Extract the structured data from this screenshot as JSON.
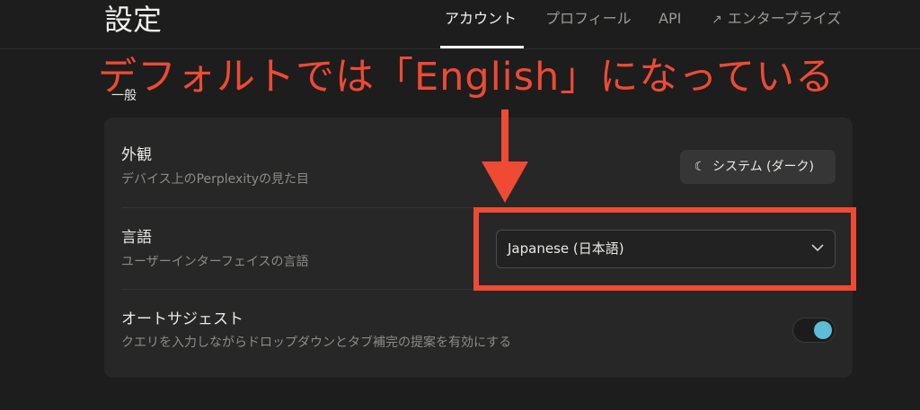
{
  "header": {
    "title": "設定",
    "tabs": [
      {
        "label": "アカウント",
        "active": true
      },
      {
        "label": "プロフィール",
        "active": false
      },
      {
        "label": "API",
        "active": false
      },
      {
        "label": "エンタープライズ",
        "active": false,
        "icon": "external-arrow-icon"
      }
    ]
  },
  "section": {
    "label": "一般"
  },
  "settings": {
    "appearance": {
      "title": "外観",
      "description": "デバイス上のPerplexityの見た目",
      "value": "システム (ダーク)",
      "icon": "moon-icon"
    },
    "language": {
      "title": "言語",
      "description": "ユーザーインターフェイスの言語",
      "selected": "Japanese (日本語)"
    },
    "autosuggest": {
      "title": "オートサジェスト",
      "description": "クエリを入力しながらドロップダウンとタブ補完の提案を有効にする",
      "enabled": true
    }
  },
  "annotation": {
    "text": "デフォルトでは「English」になっている",
    "color": "#ee4a34"
  },
  "colors": {
    "background": "#1d1d1d",
    "card": "#272727",
    "toggle_on": "#5fbcd6"
  }
}
